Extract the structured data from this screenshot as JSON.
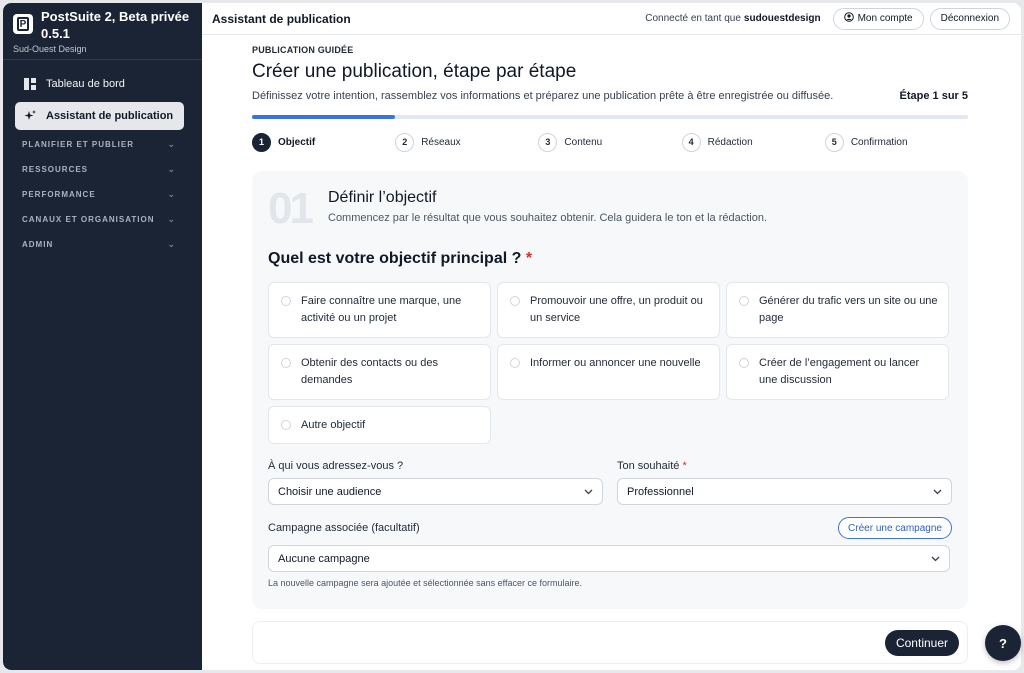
{
  "app": {
    "name": "PostSuite 2, Beta privée 0.5.1",
    "org": "Sud-Ouest Design"
  },
  "sidebar": {
    "items": [
      {
        "label": "Tableau de bord",
        "icon": "dashboard-icon"
      },
      {
        "label": "Assistant de publication",
        "icon": "sparkle-icon",
        "active": true
      }
    ],
    "groups": [
      "PLANIFIER ET PUBLIER",
      "RESSOURCES",
      "PERFORMANCE",
      "CANAUX ET ORGANISATION",
      "ADMIN"
    ]
  },
  "topbar": {
    "title": "Assistant de publication",
    "connected_prefix": "Connecté en tant que",
    "username": "sudouestdesign",
    "account_label": "Mon compte",
    "logout_label": "Déconnexion"
  },
  "page": {
    "eyebrow": "PUBLICATION GUIDÉE",
    "title": "Créer une publication, étape par étape",
    "description": "Définissez votre intention, rassemblez vos informations et préparez une publication prête à être enregistrée ou diffusée.",
    "step_indicator": "Étape 1 sur 5",
    "progress_fraction": 0.2
  },
  "stepper": [
    {
      "num": "1",
      "label": "Objectif",
      "active": true
    },
    {
      "num": "2",
      "label": "Réseaux"
    },
    {
      "num": "3",
      "label": "Contenu"
    },
    {
      "num": "4",
      "label": "Rédaction"
    },
    {
      "num": "5",
      "label": "Confirmation"
    }
  ],
  "card": {
    "number": "01",
    "title": "Définir l’objectif",
    "description": "Commencez par le résultat que vous souhaitez obtenir. Cela guidera le ton et la rédaction.",
    "question": "Quel est votre objectif principal ?",
    "required_mark": "*",
    "options": [
      "Faire connaître une marque, une activité ou un projet",
      "Promouvoir une offre, un produit ou un service",
      "Générer du trafic vers un site ou une page",
      "Obtenir des contacts ou des demandes",
      "Informer ou annoncer une nouvelle",
      "Créer de l’engagement ou lancer une discussion",
      "Autre objectif"
    ],
    "audience": {
      "label": "À qui vous adressez-vous ?",
      "value": "Choisir une audience"
    },
    "tone": {
      "label": "Ton souhaité",
      "required_mark": "*",
      "value": "Professionnel"
    },
    "campaign": {
      "label": "Campagne associée (facultatif)",
      "create_label": "Créer une campagne",
      "value": "Aucune campagne",
      "hint": "La nouvelle campagne sera ajoutée et sélectionnée sans effacer ce formulaire."
    }
  },
  "footer": {
    "continue_label": "Continuer"
  },
  "help": {
    "label": "?"
  },
  "colors": {
    "sidebar_bg": "#1b2434",
    "accent": "#3b74e0",
    "required": "#d92d20"
  }
}
